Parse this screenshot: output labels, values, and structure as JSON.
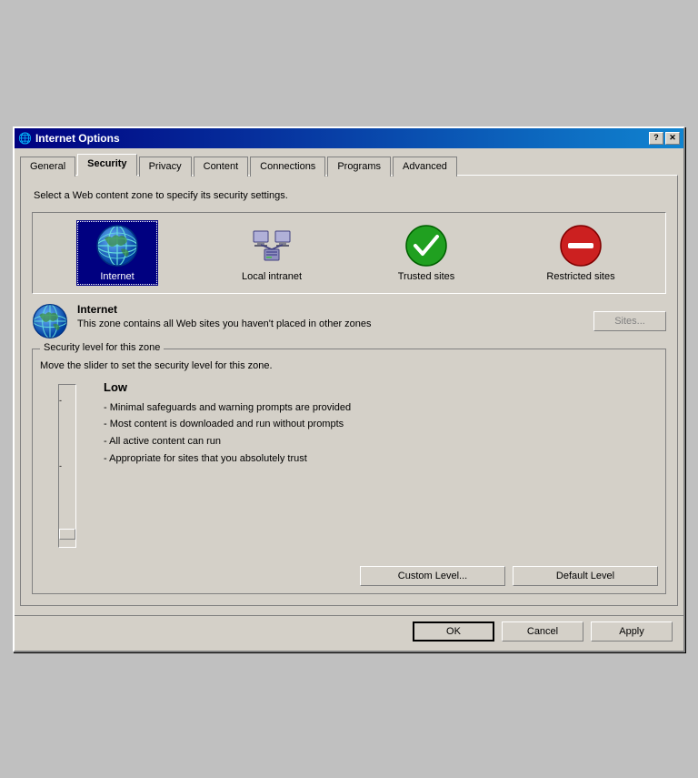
{
  "dialog": {
    "title": "Internet Options"
  },
  "tabs": [
    {
      "label": "General",
      "active": false
    },
    {
      "label": "Security",
      "active": true
    },
    {
      "label": "Privacy",
      "active": false
    },
    {
      "label": "Content",
      "active": false
    },
    {
      "label": "Connections",
      "active": false
    },
    {
      "label": "Programs",
      "active": false
    },
    {
      "label": "Advanced",
      "active": false
    }
  ],
  "security": {
    "instruction": "Select a Web content zone to specify its security settings.",
    "zones": [
      {
        "id": "internet",
        "label": "Internet",
        "selected": true
      },
      {
        "id": "local-intranet",
        "label": "Local intranet",
        "selected": false
      },
      {
        "id": "trusted-sites",
        "label": "Trusted sites",
        "selected": false
      },
      {
        "id": "restricted-sites",
        "label": "Restricted sites",
        "selected": false
      }
    ],
    "selected_zone_title": "Internet",
    "selected_zone_desc": "This zone contains all Web sites you haven't placed in other zones",
    "sites_button": "Sites...",
    "security_level_legend": "Security level for this zone",
    "slider_instruction": "Move the slider to set the security level for this zone.",
    "level_title": "Low",
    "level_bullets": [
      "- Minimal safeguards and warning prompts are provided",
      "- Most content is downloaded and run without prompts",
      "- All active content can run",
      "- Appropriate for sites that you absolutely trust"
    ],
    "custom_level_btn": "Custom Level...",
    "default_level_btn": "Default Level"
  },
  "buttons": {
    "ok": "OK",
    "cancel": "Cancel",
    "apply": "Apply"
  }
}
